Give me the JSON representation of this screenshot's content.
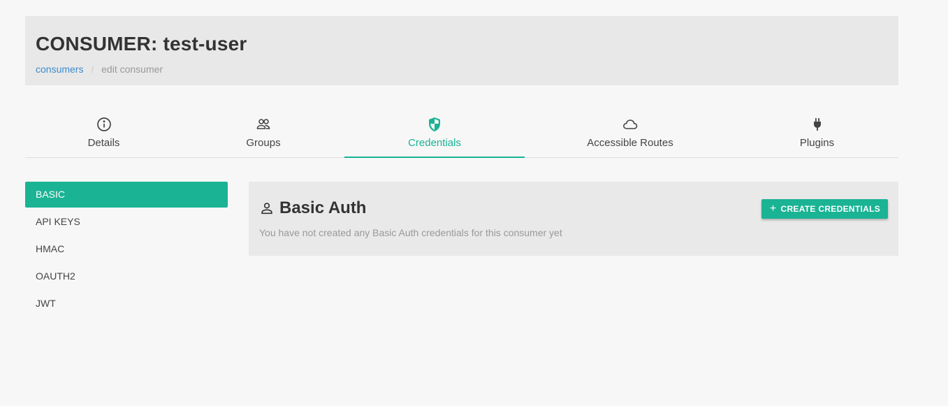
{
  "header": {
    "title": "CONSUMER: test-user",
    "breadcrumb": {
      "link": "consumers",
      "separator": "/",
      "current": "edit consumer"
    }
  },
  "tabs": [
    {
      "label": "Details",
      "icon": "info-icon",
      "active": false
    },
    {
      "label": "Groups",
      "icon": "users-icon",
      "active": false
    },
    {
      "label": "Credentials",
      "icon": "shield-icon",
      "active": true
    },
    {
      "label": "Accessible Routes",
      "icon": "cloud-icon",
      "active": false
    },
    {
      "label": "Plugins",
      "icon": "plug-icon",
      "active": false
    }
  ],
  "sidenav": {
    "items": [
      {
        "label": "BASIC",
        "active": true
      },
      {
        "label": "API KEYS",
        "active": false
      },
      {
        "label": "HMAC",
        "active": false
      },
      {
        "label": "OAUTH2",
        "active": false
      },
      {
        "label": "JWT",
        "active": false
      }
    ]
  },
  "panel": {
    "title": "Basic Auth",
    "title_icon": "user-icon",
    "empty_text": "You have not created any Basic Auth credentials for this consumer yet",
    "create_button": {
      "icon": "plus-icon",
      "label": "CREATE CREDENTIALS"
    }
  },
  "colors": {
    "accent": "#1ab394",
    "link": "#3d8bcd",
    "header_bg": "#e8e8e8",
    "page_bg": "#f7f7f7"
  }
}
